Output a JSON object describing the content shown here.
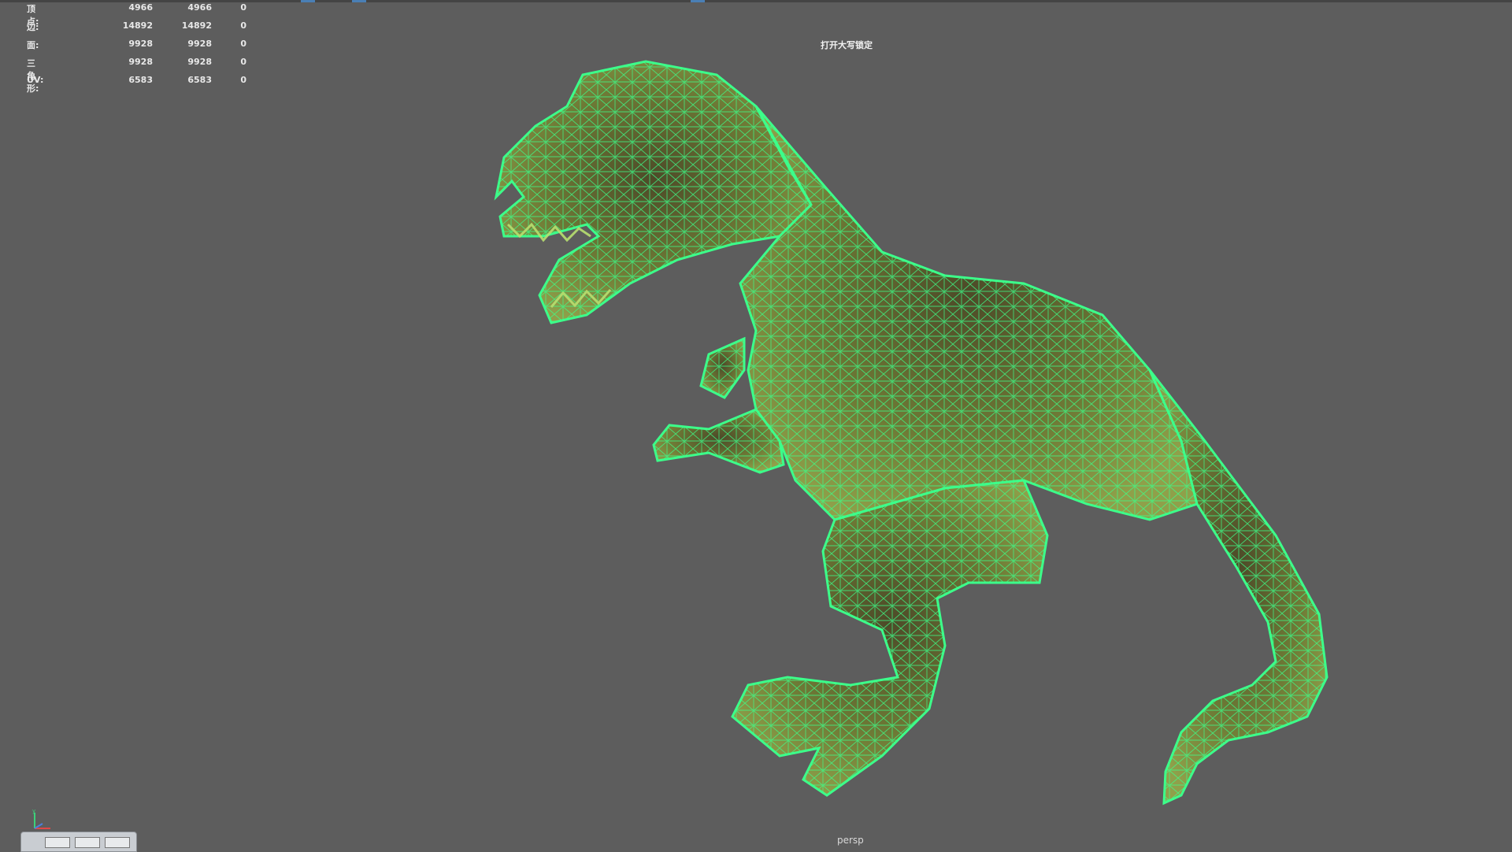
{
  "hud": {
    "rows": [
      {
        "label": "顶点:",
        "c1": "4966",
        "c2": "4966",
        "c3": "0"
      },
      {
        "label": "边:",
        "c1": "14892",
        "c2": "14892",
        "c3": "0"
      },
      {
        "label": "面:",
        "c1": "9928",
        "c2": "9928",
        "c3": "0"
      },
      {
        "label": "三角形:",
        "c1": "9928",
        "c2": "9928",
        "c3": "0"
      },
      {
        "label": "UV:",
        "c1": "6583",
        "c2": "6583",
        "c3": "0"
      }
    ]
  },
  "viewport": {
    "message": "打开大写锁定",
    "camera": "persp"
  },
  "colors": {
    "background": "#5d5d5d",
    "wireframe": "#3cff8a",
    "mesh_fill": "#7a8a3a"
  },
  "icons": {
    "axis": "axis-gizmo-icon",
    "model": "t-rex-wireframe-model"
  }
}
